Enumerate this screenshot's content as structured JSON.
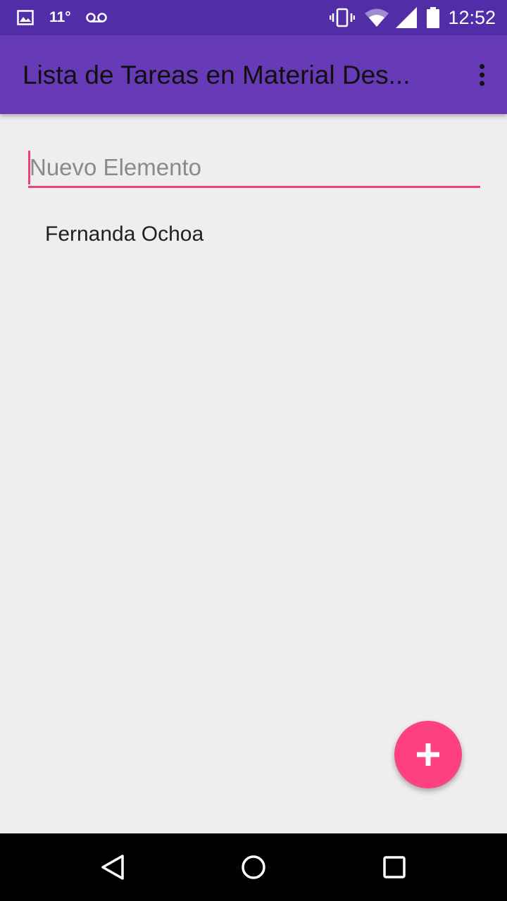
{
  "status_bar": {
    "temperature": "11°",
    "time": "12:52",
    "icons": [
      "image-icon",
      "voicemail-icon",
      "vibrate-icon",
      "wifi-icon",
      "signal-icon",
      "battery-icon"
    ],
    "background_color": "#512da8"
  },
  "app_bar": {
    "title": "Lista de Tareas en Material Des...",
    "overflow_icon": "more-vert-icon",
    "background_color": "#673ab7"
  },
  "new_item": {
    "placeholder": "Nuevo Elemento",
    "value": "",
    "accent_color": "#ec407a"
  },
  "tasks": [
    {
      "label": "Fernanda Ochoa"
    }
  ],
  "fab": {
    "icon": "plus-icon",
    "color": "#ff4081"
  },
  "navigation_bar": {
    "icons": [
      "back-icon",
      "home-icon",
      "recents-icon"
    ]
  }
}
